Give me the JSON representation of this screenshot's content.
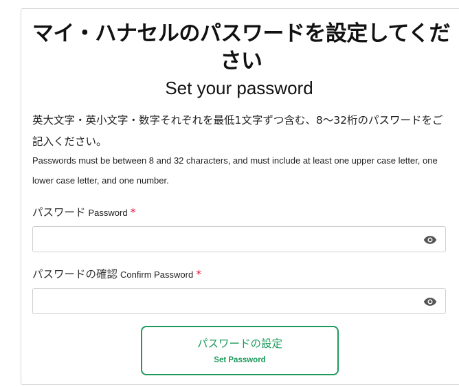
{
  "title": {
    "ja": "マイ・ハナセルのパスワードを設定してください",
    "en": "Set your password"
  },
  "description": {
    "ja": "英大文字・英小文字・数字それぞれを最低1文字ずつ含む、8〜32桁のパスワードをご記入ください。",
    "en": "Passwords must be between 8 and 32 characters, and must include at least one upper case letter, one lower case letter, and one number."
  },
  "fields": {
    "password": {
      "label_ja": "パスワード",
      "label_en": "Password",
      "required_mark": "*",
      "value": "",
      "icon": "eye-icon"
    },
    "confirm": {
      "label_ja": "パスワードの確認",
      "label_en": "Confirm Password",
      "required_mark": "*",
      "value": "",
      "icon": "eye-icon"
    }
  },
  "submit": {
    "label_ja": "パスワードの設定",
    "label_en": "Set Password"
  },
  "colors": {
    "accent": "#1c9a5b",
    "required": "#e0123b",
    "border": "#cfcfcf"
  }
}
